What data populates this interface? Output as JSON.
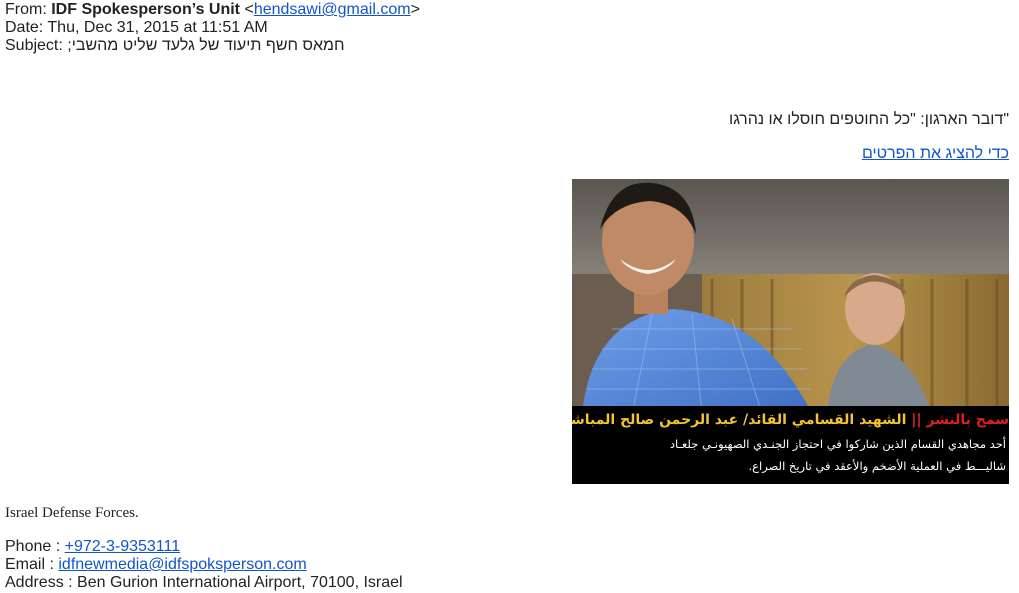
{
  "header": {
    "from_label": "From:",
    "from_name": "IDF Spokesperson’s Unit",
    "from_email_open": "<",
    "from_email": "hendsawi@gmail.com",
    "from_email_close": ">",
    "date_label": "Date:",
    "date_value": "Thu, Dec 31, 2015 at 11:51 AM",
    "subject_label": "Subject:",
    "subject_value": "חמאס חשף תיעוד של גלעד שליט מהשבי;"
  },
  "body": {
    "quote_line": "\"דובר הארגון: \"כל החוטפים חוסלו או נהרגו",
    "details_link": "כדי להציג את הפרטים",
    "image_caption": {
      "title_red": "سمح بالنشر ||",
      "title_yellow": "الشهيد القسامي القائد/ عبد الرحمن صالح المباشر",
      "line1": "أحد مجاهدي القسام الذين شاركوا في احتجاز الجنـدي الصهيونـي جلعـاد",
      "line2": "شاليـــط في العملية الأضخم والأعقد في تاريخ الصراع."
    }
  },
  "signature": {
    "org": "Israel Defense Forces.",
    "phone_label": "Phone :",
    "phone_value": "+972-3-9353111",
    "email_label": "Email :",
    "email_value": "idfnewmedia@idfspoksperson.com",
    "address_label": "Address :",
    "address_value": "Ben Gurion International Airport, 70100, Israel"
  },
  "colors": {
    "link": "#1155cc",
    "text": "#222222",
    "caption_red": "#e02020",
    "caption_yellow": "#f4c430"
  }
}
